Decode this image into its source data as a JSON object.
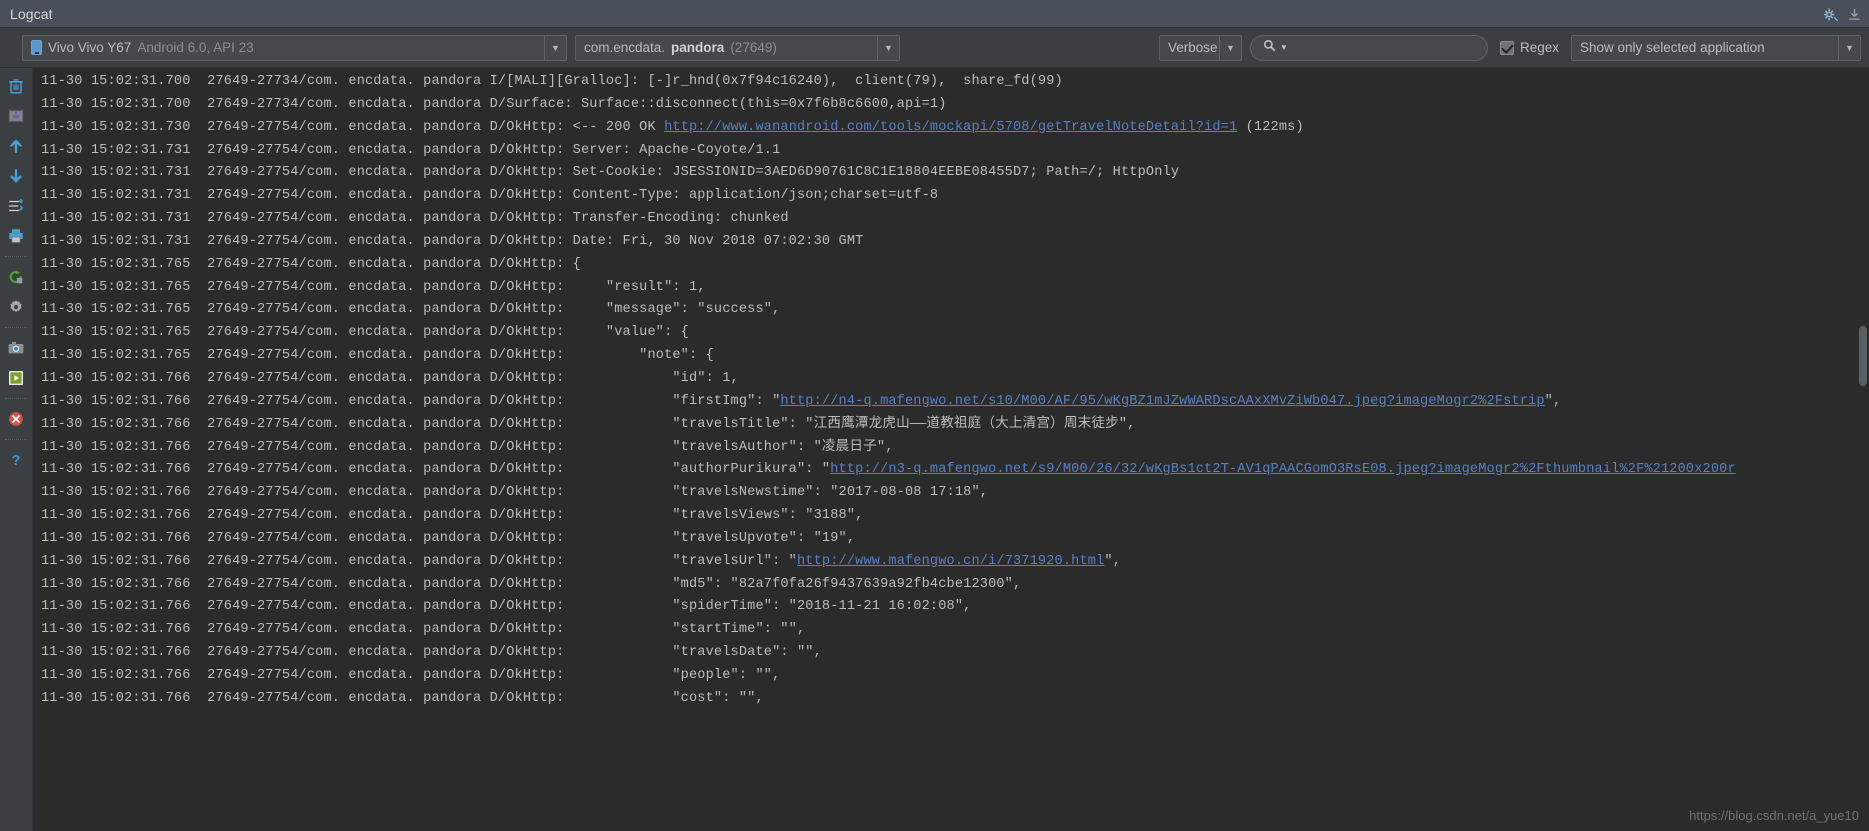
{
  "window": {
    "tab_label": "Logcat",
    "settings_icon": "gear-icon",
    "minimize_icon": "minimize-icon"
  },
  "toolbar": {
    "device": {
      "vendor_model": "Vivo Vivo Y67",
      "os": "Android 6.0, API 23",
      "icon": "phone-icon"
    },
    "process": {
      "package_prefix": "com.encdata.",
      "package_name": "pandora",
      "pid": "(27649)"
    },
    "log_level": "Verbose",
    "search": {
      "placeholder": "",
      "value": "",
      "icon": "search-icon"
    },
    "regex_label": "Regex",
    "regex_checked": true,
    "scope_filter": "Show only selected application"
  },
  "sidebar": {
    "items": [
      {
        "name": "clear-logcat-button",
        "icon": "trash-icon"
      },
      {
        "name": "scroll-to-end-button",
        "icon": "download-box-icon"
      },
      {
        "name": "up-the-stack-trace-button",
        "icon": "arrow-up-icon"
      },
      {
        "name": "down-the-stack-trace-button",
        "icon": "arrow-down-icon"
      },
      {
        "name": "use-soft-wraps-button",
        "icon": "soft-wrap-icon"
      },
      {
        "name": "print-button",
        "icon": "printer-icon"
      },
      {
        "name": "restart-button",
        "icon": "restart-icon"
      },
      {
        "name": "settings-button",
        "icon": "gear-icon"
      },
      {
        "name": "screen-capture-button",
        "icon": "camera-icon"
      },
      {
        "name": "screen-record-button",
        "icon": "play-icon"
      },
      {
        "name": "terminate-application-button",
        "icon": "stop-error-icon"
      },
      {
        "name": "help-button",
        "icon": "question-mark-icon"
      }
    ]
  },
  "log": {
    "lines": [
      {
        "prefix": "11-30 15:02:31.700  27649-27734/com. encdata. pandora I/[MALI][Gralloc]: [-]r_hnd(0x7f94c16240),  client(79),  share_fd(99)"
      },
      {
        "prefix": "11-30 15:02:31.700  27649-27734/com. encdata. pandora D/Surface: Surface::disconnect(this=0x7f6b8c6600,api=1)"
      },
      {
        "prefix": "11-30 15:02:31.730  27649-27754/com. encdata. pandora D/OkHttp: <-- 200 OK ",
        "link": "http://www.wanandroid.com/tools/mockapi/5708/getTravelNoteDetail?id=1",
        "suffix": " (122ms)"
      },
      {
        "prefix": "11-30 15:02:31.731  27649-27754/com. encdata. pandora D/OkHttp: Server: Apache-Coyote/1.1"
      },
      {
        "prefix": "11-30 15:02:31.731  27649-27754/com. encdata. pandora D/OkHttp: Set-Cookie: JSESSIONID=3AED6D90761C8C1E18804EEBE08455D7; Path=/; HttpOnly"
      },
      {
        "prefix": "11-30 15:02:31.731  27649-27754/com. encdata. pandora D/OkHttp: Content-Type: application/json;charset=utf-8"
      },
      {
        "prefix": "11-30 15:02:31.731  27649-27754/com. encdata. pandora D/OkHttp: Transfer-Encoding: chunked"
      },
      {
        "prefix": "11-30 15:02:31.731  27649-27754/com. encdata. pandora D/OkHttp: Date: Fri, 30 Nov 2018 07:02:30 GMT"
      },
      {
        "prefix": "11-30 15:02:31.765  27649-27754/com. encdata. pandora D/OkHttp: {"
      },
      {
        "prefix": "11-30 15:02:31.765  27649-27754/com. encdata. pandora D/OkHttp:     \"result\": 1,"
      },
      {
        "prefix": "11-30 15:02:31.765  27649-27754/com. encdata. pandora D/OkHttp:     \"message\": \"success\","
      },
      {
        "prefix": "11-30 15:02:31.765  27649-27754/com. encdata. pandora D/OkHttp:     \"value\": {"
      },
      {
        "prefix": "11-30 15:02:31.765  27649-27754/com. encdata. pandora D/OkHttp:         \"note\": {"
      },
      {
        "prefix": "11-30 15:02:31.766  27649-27754/com. encdata. pandora D/OkHttp:             \"id\": 1,"
      },
      {
        "prefix": "11-30 15:02:31.766  27649-27754/com. encdata. pandora D/OkHttp:             \"firstImg\": \"",
        "link": "http://n4-q.mafengwo.net/s10/M00/AF/95/wKgBZ1mJZwWARDscAAxXMvZiWb047.jpeg?imageMogr2%2Fstrip",
        "suffix": "\","
      },
      {
        "prefix": "11-30 15:02:31.766  27649-27754/com. encdata. pandora D/OkHttp:             \"travelsTitle\": \"江西鹰潭龙虎山——道教祖庭（大上清宫）周末徒步\","
      },
      {
        "prefix": "11-30 15:02:31.766  27649-27754/com. encdata. pandora D/OkHttp:             \"travelsAuthor\": \"凌晨日子\","
      },
      {
        "prefix": "11-30 15:02:31.766  27649-27754/com. encdata. pandora D/OkHttp:             \"authorPurikura\": \"",
        "link": "http://n3-q.mafengwo.net/s9/M00/26/32/wKgBs1ct2T-AV1qPAACGomO3RsE08.jpeg?imageMogr2%2Fthumbnail%2F%21200x200r"
      },
      {
        "prefix": "11-30 15:02:31.766  27649-27754/com. encdata. pandora D/OkHttp:             \"travelsNewstime\": \"2017-08-08 17:18\","
      },
      {
        "prefix": "11-30 15:02:31.766  27649-27754/com. encdata. pandora D/OkHttp:             \"travelsViews\": \"3188\","
      },
      {
        "prefix": "11-30 15:02:31.766  27649-27754/com. encdata. pandora D/OkHttp:             \"travelsUpvote\": \"19\","
      },
      {
        "prefix": "11-30 15:02:31.766  27649-27754/com. encdata. pandora D/OkHttp:             \"travelsUrl\": \"",
        "link": "http://www.mafengwo.cn/i/7371920.html",
        "suffix": "\","
      },
      {
        "prefix": "11-30 15:02:31.766  27649-27754/com. encdata. pandora D/OkHttp:             \"md5\": \"82a7f0fa26f9437639a92fb4cbe12300\","
      },
      {
        "prefix": "11-30 15:02:31.766  27649-27754/com. encdata. pandora D/OkHttp:             \"spiderTime\": \"2018-11-21 16:02:08\","
      },
      {
        "prefix": "11-30 15:02:31.766  27649-27754/com. encdata. pandora D/OkHttp:             \"startTime\": \"\","
      },
      {
        "prefix": "11-30 15:02:31.766  27649-27754/com. encdata. pandora D/OkHttp:             \"travelsDate\": \"\","
      },
      {
        "prefix": "11-30 15:02:31.766  27649-27754/com. encdata. pandora D/OkHttp:             \"people\": \"\","
      },
      {
        "prefix": "11-30 15:02:31.766  27649-27754/com. encdata. pandora D/OkHttp:             \"cost\": \"\","
      }
    ]
  },
  "watermark": "https://blog.csdn.net/a_yue10",
  "colors": {
    "background": "#2b2b2b",
    "chrome": "#3c3f41",
    "titlebar": "#4a5059",
    "text": "#bcbcbc",
    "link": "#5781c4",
    "accent_blue": "#5f97c9"
  }
}
